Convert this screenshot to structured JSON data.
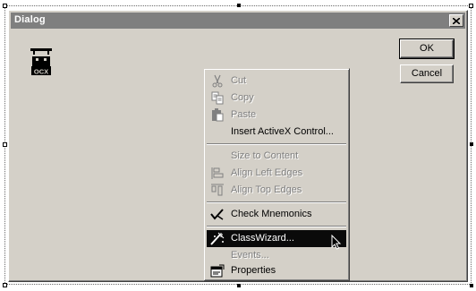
{
  "dialog": {
    "title": "Dialog",
    "close_icon": "close-icon",
    "ok_label": "OK",
    "cancel_label": "Cancel",
    "control_icon": "activex-control-icon",
    "control_text": "OCX"
  },
  "context_menu": {
    "items": [
      {
        "label": "Cut",
        "icon": "scissors-icon",
        "enabled": false
      },
      {
        "label": "Copy",
        "icon": "copy-icon",
        "enabled": false
      },
      {
        "label": "Paste",
        "icon": "paste-icon",
        "enabled": false
      },
      {
        "label": "Insert ActiveX Control...",
        "icon": "",
        "enabled": true
      },
      {
        "label": "Size to Content",
        "icon": "",
        "enabled": false
      },
      {
        "label": "Align Left Edges",
        "icon": "align-left-icon",
        "enabled": false
      },
      {
        "label": "Align Top Edges",
        "icon": "align-top-icon",
        "enabled": false
      },
      {
        "label": "Check Mnemonics",
        "icon": "check-mnemonics-icon",
        "enabled": true
      },
      {
        "label": "ClassWizard...",
        "icon": "classwizard-icon",
        "enabled": true,
        "selected": true
      },
      {
        "label": "Events...",
        "icon": "",
        "enabled": false
      },
      {
        "label": "Properties",
        "icon": "properties-icon",
        "enabled": true
      }
    ]
  },
  "colors": {
    "face": "#d4d0c8",
    "title_bar": "#7f7f7f",
    "highlight": "#0a0a0a"
  }
}
